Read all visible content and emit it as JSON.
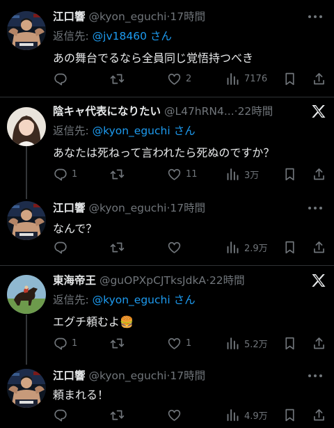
{
  "tweets": [
    {
      "name": "江口響",
      "meta": "@kyon_eguchi·17時間",
      "reply_prefix": "返信先: ",
      "reply_handle": "@jv18460",
      "reply_suffix": "さん",
      "text": "あの舞台でるなら全員同じ覚悟持つべき",
      "replies": "",
      "retweets": "",
      "likes": "2",
      "views": "7176"
    },
    {
      "name": "陰キャ代表になりたい",
      "meta": "@L47hRN4...·22時間",
      "reply_prefix": "返信先: ",
      "reply_handle": "@kyon_eguchi",
      "reply_suffix": "さん",
      "text": "あなたは死ねって言われたら死ぬのですか？",
      "replies": "1",
      "retweets": "",
      "likes": "11",
      "views": "3万"
    },
    {
      "name": "江口響",
      "meta": "@kyon_eguchi·17時間",
      "text": "なんで？",
      "replies": "",
      "retweets": "",
      "likes": "",
      "views": "2.9万"
    },
    {
      "name": "東海帝王",
      "meta": "@guOPXpCJTksJdkA·22時間",
      "reply_prefix": "返信先: ",
      "reply_handle": "@kyon_eguchi",
      "reply_suffix": "さん",
      "text": "エグチ頼むよ🍔",
      "replies": "1",
      "retweets": "",
      "likes": "1",
      "views": "5.2万"
    },
    {
      "name": "江口響",
      "meta": "@kyon_eguchi·17時間",
      "text": "頼まれる！",
      "replies": "",
      "retweets": "",
      "likes": "",
      "views": "4.9万"
    }
  ],
  "icons": {
    "reply": "reply-icon",
    "retweet": "retweet-icon",
    "like": "heart-icon",
    "views": "views-icon",
    "bookmark": "bookmark-icon",
    "share": "share-icon",
    "more": "more-icon",
    "platform": "x-logo-icon"
  },
  "colors": {
    "background": "#000000",
    "text": "#e7e9ea",
    "muted": "#71767b",
    "link": "#1d9bf0",
    "divider": "#2f3336"
  }
}
